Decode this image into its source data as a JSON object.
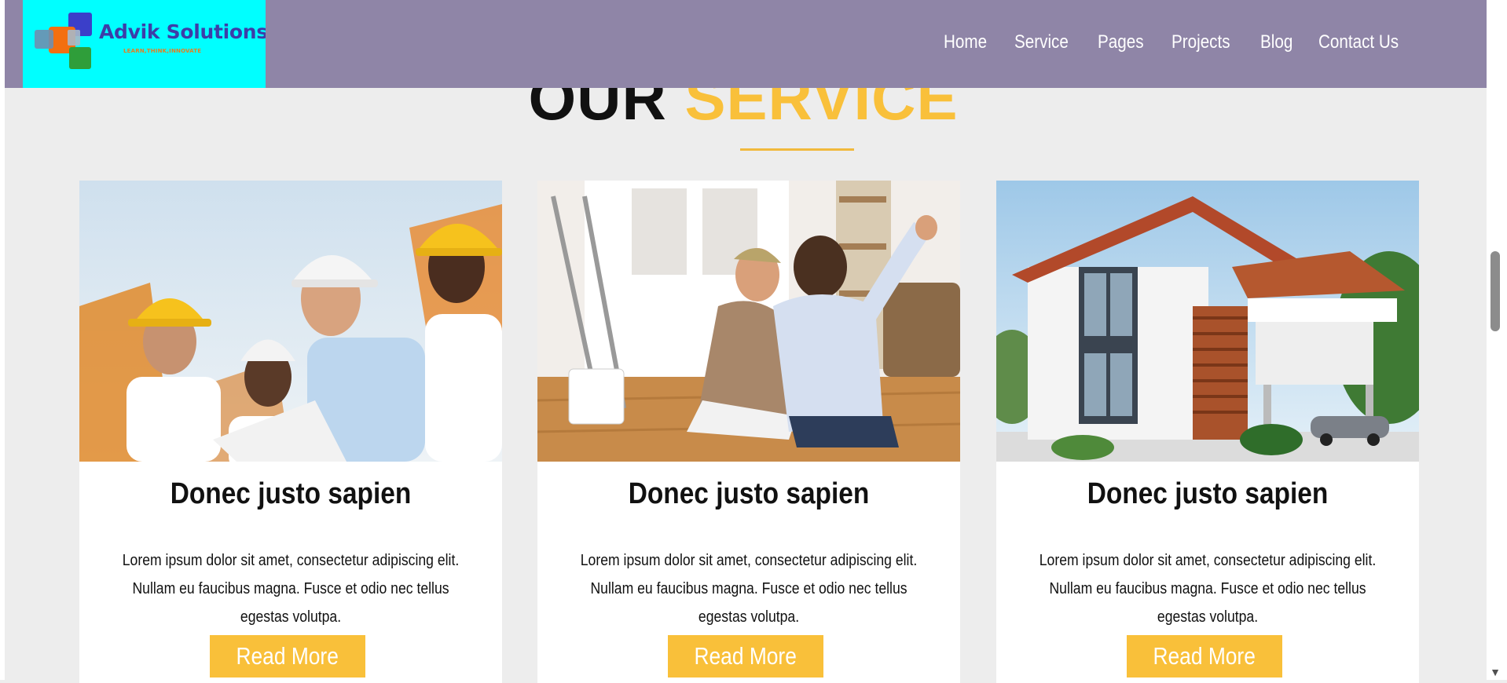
{
  "logo": {
    "name": "Advik Solutions",
    "tagline": "LEARN,THINK,INNOVATE"
  },
  "nav": {
    "items": [
      "Home",
      "Service",
      "Pages",
      "Projects",
      "Blog",
      "Contact Us"
    ]
  },
  "section": {
    "title_part1": "OUR",
    "title_part2": "SERVICE"
  },
  "cards": [
    {
      "title": "Donec justo sapien",
      "text": "Lorem ipsum dolor sit amet, consectetur adipiscing elit. Nullam eu faucibus magna. Fusce et odio nec tellus egestas volutpa.",
      "button": "Read More",
      "image": "construction-workers-photo"
    },
    {
      "title": "Donec justo sapien",
      "text": "Lorem ipsum dolor sit amet, consectetur adipiscing elit. Nullam eu faucibus magna. Fusce et odio nec tellus egestas volutpa.",
      "button": "Read More",
      "image": "couple-in-room-photo"
    },
    {
      "title": "Donec justo sapien",
      "text": "Lorem ipsum dolor sit amet, consectetur adipiscing elit. Nullam eu faucibus magna. Fusce et odio nec tellus egestas volutpa.",
      "button": "Read More",
      "image": "modern-house-photo"
    }
  ],
  "colors": {
    "header_bg": "#8f85a7",
    "accent": "#f9c03a",
    "logo_bg": "#00ffff",
    "page_bg": "#ededed"
  }
}
